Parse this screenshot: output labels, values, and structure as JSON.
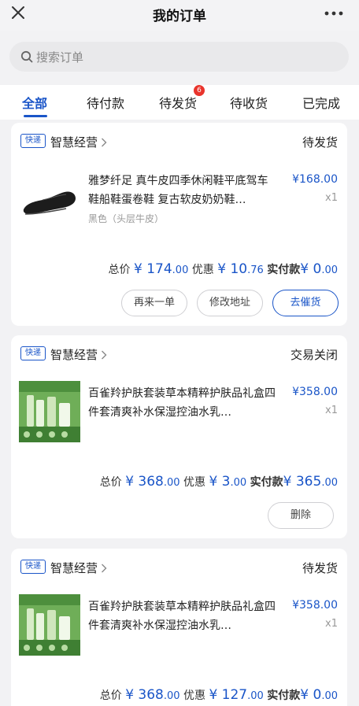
{
  "header": {
    "title": "我的订单",
    "close_icon": "close-icon",
    "more_icon": "more-dots-icon"
  },
  "search": {
    "placeholder": "搜索订单",
    "icon": "search-icon"
  },
  "tabs": [
    {
      "label": "全部",
      "active": true
    },
    {
      "label": "待付款"
    },
    {
      "label": "待发货",
      "badge": "6"
    },
    {
      "label": "待收货"
    },
    {
      "label": "已完成"
    }
  ],
  "colors": {
    "accent": "#1a55c8",
    "badge": "#e9342c"
  },
  "orders": [
    {
      "tag": "快递",
      "shop": "智慧经营",
      "status": "待发货",
      "product_title": "雅梦纤足 真牛皮四季休闲鞋平底驾车鞋船鞋蛋卷鞋 复古软皮奶奶鞋…",
      "variant": "黑色（头层牛皮）",
      "price": "¥168.00",
      "qty": "x1",
      "summary": {
        "total_label": "总价",
        "total_int": "¥ 174",
        "total_dec": ".00",
        "discount_label": "优惠",
        "discount_int": "¥ 10",
        "discount_dec": ".76",
        "paid_label": "实付款",
        "paid_int": "¥ 0",
        "paid_dec": ".00"
      },
      "buttons": [
        "再来一单",
        "修改地址",
        "去催货"
      ]
    },
    {
      "tag": "快递",
      "shop": "智慧经营",
      "status": "交易关闭",
      "product_title": "百雀羚护肤套装草本精粹护肤品礼盒四件套清爽补水保湿控油水乳…",
      "price": "¥358.00",
      "qty": "x1",
      "summary": {
        "total_label": "总价",
        "total_int": "¥ 368",
        "total_dec": ".00",
        "discount_label": "优惠",
        "discount_int": "¥ 3",
        "discount_dec": ".00",
        "paid_label": "实付款",
        "paid_int": "¥ 365",
        "paid_dec": ".00"
      },
      "buttons": [
        "删除"
      ]
    },
    {
      "tag": "快递",
      "shop": "智慧经营",
      "status": "待发货",
      "product_title": "百雀羚护肤套装草本精粹护肤品礼盒四件套清爽补水保湿控油水乳…",
      "price": "¥358.00",
      "qty": "x1",
      "summary": {
        "total_label": "总价",
        "total_int": "¥ 368",
        "total_dec": ".00",
        "discount_label": "优惠",
        "discount_int": "¥ 127",
        "discount_dec": ".00",
        "paid_label": "实付款",
        "paid_int": "¥ 0",
        "paid_dec": ".00"
      }
    }
  ]
}
